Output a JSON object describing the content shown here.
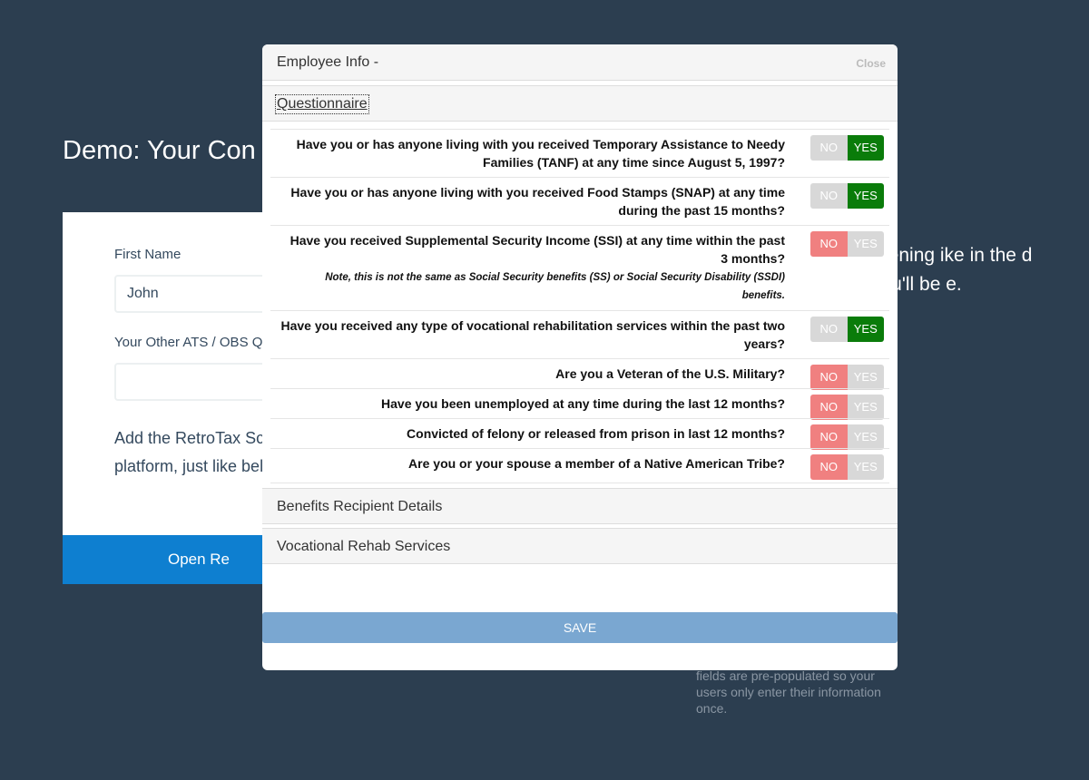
{
  "background": {
    "title": "Demo: Your Con",
    "first_name_label": "First Name",
    "first_name_value": "John",
    "ats_label": "Your Other ATS / OBS Q",
    "paragraph": "Add the RetroTax Sc your Applicant Track platform, just like bel",
    "open_button": "Open Re",
    "right_text": "reening ike in the d you'll be e.",
    "note": "fields are pre-populated so your users only enter their information once."
  },
  "modal": {
    "title": "Employee Info -",
    "close_label": "Close",
    "sections": {
      "questionnaire": "Questionnaire",
      "benefits": "Benefits Recipient Details",
      "vocational": "Vocational Rehab Services"
    },
    "toggle_no": "NO",
    "toggle_yes": "YES",
    "questions": [
      {
        "text": "Have you or has anyone living with you received Temporary Assistance to Needy Families (TANF) at any time since August 5, 1997?",
        "answer": "yes"
      },
      {
        "text": "Have you or has anyone living with you received Food Stamps (SNAP) at any time during the past 15 months?",
        "answer": "yes"
      },
      {
        "text": "Have you received Supplemental Security Income (SSI) at any time within the past 3 months?",
        "note": "Note, this is not the same as Social Security benefits (SS) or Social Security Disability (SSDI) benefits.",
        "answer": "no"
      },
      {
        "text": "Have you received any type of vocational rehabilitation services within the past two years?",
        "answer": "yes"
      },
      {
        "text": "Are you a Veteran of the U.S. Military?",
        "answer": "no"
      },
      {
        "text": "Have you been unemployed at any time during the last 12 months?",
        "answer": "no"
      },
      {
        "text": "Convicted of felony or released from prison in last 12 months?",
        "answer": "no"
      },
      {
        "text": "Are you or your spouse a member of a Native American Tribe?",
        "answer": "no"
      }
    ],
    "save_label": "SAVE"
  },
  "colors": {
    "page_bg": "#2c3e50",
    "yes_active": "#0a7c0a",
    "no_active": "#f08080",
    "toggle_inactive": "#d8d8d8",
    "save_bg": "#7aa7d1"
  }
}
